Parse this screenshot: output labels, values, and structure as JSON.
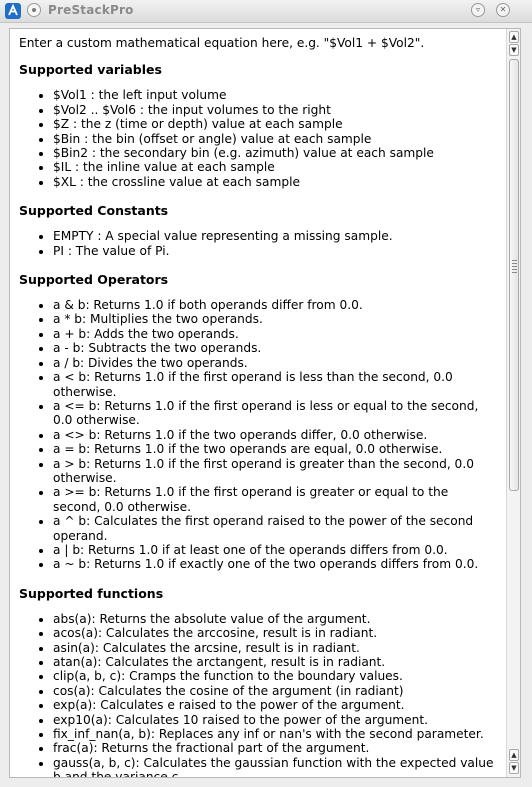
{
  "window": {
    "title": "PreStackPro",
    "icons": {
      "app": "prestackpro-app-icon",
      "menu": "window-menu-icon",
      "minimize": "minimize-icon",
      "close": "close-icon"
    }
  },
  "help": {
    "intro": "Enter a custom mathematical equation here, e.g. \"$Vol1 + $Vol2\".",
    "sections": {
      "variables": {
        "heading": "Supported variables",
        "items": [
          "$Vol1 : the left input volume",
          "$Vol2 .. $Vol6 : the input volumes to the right",
          "$Z : the z (time or depth) value at each sample",
          "$Bin : the bin (offset or angle) value at each sample",
          "$Bin2 : the secondary bin (e.g. azimuth) value at each sample",
          "$IL : the inline value at each sample",
          "$XL : the crossline value at each sample"
        ]
      },
      "constants": {
        "heading": "Supported Constants",
        "items": [
          "EMPTY : A special value representing a missing sample.",
          "PI : The value of Pi."
        ]
      },
      "operators": {
        "heading": "Supported Operators",
        "items": [
          "a & b: Returns 1.0 if both operands differ from 0.0.",
          "a * b: Multiplies the two operands.",
          "a + b: Adds the two operands.",
          "a - b: Subtracts the two operands.",
          "a / b: Divides the two operands.",
          "a < b: Returns 1.0 if the first operand is less than the second, 0.0 otherwise.",
          "a <= b: Returns 1.0 if the first operand is less or equal to the second, 0.0 otherwise.",
          "a <> b: Returns 1.0 if the two operands differ, 0.0 otherwise.",
          "a = b: Returns 1.0 if the two operands are equal, 0.0 otherwise.",
          "a > b: Returns 1.0 if the first operand is greater than the second, 0.0 otherwise.",
          "a >= b: Returns 1.0 if the first operand is greater or equal to the second, 0.0 otherwise.",
          "a ^ b: Calculates the first operand raised to the power of the second operand.",
          "a | b: Returns 1.0 if at least one of the operands differs from 0.0.",
          "a ~ b: Returns 1.0 if exactly one of the two operands differs from 0.0."
        ]
      },
      "functions": {
        "heading": "Supported functions",
        "items": [
          "abs(a): Returns the absolute value of the argument.",
          "acos(a): Calculates the arccosine, result is in radiant.",
          "asin(a): Calculates the arcsine, result is in radiant.",
          "atan(a): Calculates the arctangent, result is in radiant.",
          "clip(a, b, c): Cramps the function to the boundary values.",
          "cos(a): Calculates the cosine of the argument (in radiant)",
          "exp(a): Calculates e raised to the power of the argument.",
          "exp10(a): Calculates 10 raised to the power of the argument.",
          "fix_inf_nan(a, b): Replaces any inf or nan's with the second parameter.",
          "frac(a): Returns the fractional part of the argument.",
          "gauss(a, b, c): Calculates the gaussian function with the expected value b and the variance c."
        ]
      }
    }
  },
  "scrollbar": {
    "position_fraction": 0.0,
    "icons": {
      "up": "scroll-up-icon",
      "down": "scroll-down-icon",
      "grip": "scroll-grip-icon"
    }
  }
}
